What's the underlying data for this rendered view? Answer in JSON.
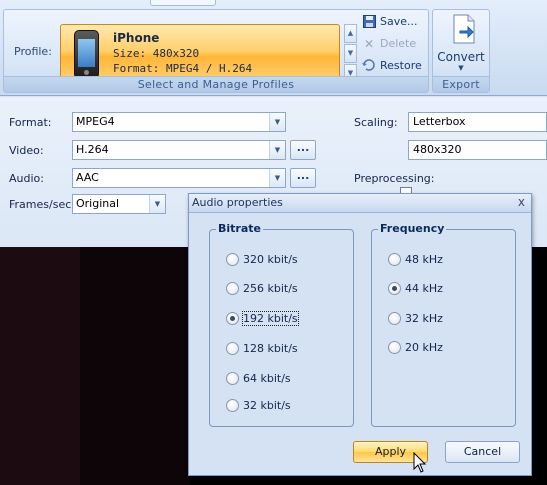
{
  "ribbon": {
    "profile_label": "Profile:",
    "profile": {
      "name": "iPhone",
      "size": "Size: 480x320",
      "format": "Format: MPEG4 / H.264",
      "icon": "iphone-icon"
    },
    "actions": {
      "save": "Save...",
      "delete": "Delete",
      "restore": "Restore"
    },
    "group_profiles_caption": "Select and Manage Profiles",
    "convert_label": "Convert",
    "group_export_caption": "Export"
  },
  "settings": {
    "format_label": "Format:",
    "format_value": "MPEG4",
    "video_label": "Video:",
    "video_value": "H.264",
    "audio_label": "Audio:",
    "audio_value": "AAC",
    "fps_label": "Frames/sec:",
    "fps_value": "Original",
    "more_button": "...",
    "scaling_label": "Scaling:",
    "scaling_value": "Letterbox",
    "resolution_value": "480x320",
    "preprocessing_label": "Preprocessing:"
  },
  "dialog": {
    "title": "Audio properties",
    "close": "x",
    "bitrate": {
      "legend": "Bitrate",
      "options": [
        "320 kbit/s",
        "256 kbit/s",
        "192 kbit/s",
        "128 kbit/s",
        "64 kbit/s",
        "32 kbit/s"
      ],
      "selected": "192 kbit/s"
    },
    "frequency": {
      "legend": "Frequency",
      "options": [
        "48 kHz",
        "44 kHz",
        "32 kHz",
        "20 kHz"
      ],
      "selected": "44 kHz"
    },
    "apply": "Apply",
    "cancel": "Cancel"
  },
  "colors": {
    "ribbon_bg": "#d6e3f3",
    "profile_highlight": "#ffc846",
    "preview_bg": "#000000"
  }
}
